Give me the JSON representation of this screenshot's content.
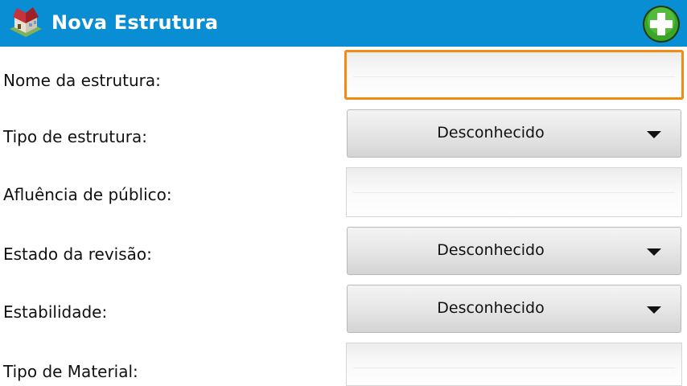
{
  "header": {
    "title": "Nova Estrutura",
    "app_icon": "house-icon",
    "add_icon": "plus-circle-icon",
    "background_color": "#0a8ed3"
  },
  "form": {
    "nome_label": "Nome da estrutura:",
    "nome_value": "",
    "tipo_label": "Tipo de estrutura:",
    "tipo_value": "Desconhecido",
    "afluencia_label": "Afluência de público:",
    "afluencia_value": "",
    "revisao_label": "Estado da revisão:",
    "revisao_value": "Desconhecido",
    "estabilidade_label": "Estabilidade:",
    "estabilidade_value": "Desconhecido",
    "material_label": "Tipo de Material:",
    "material_value": ""
  },
  "colors": {
    "focus": "#f08c14",
    "add_button": "#3aa527"
  }
}
